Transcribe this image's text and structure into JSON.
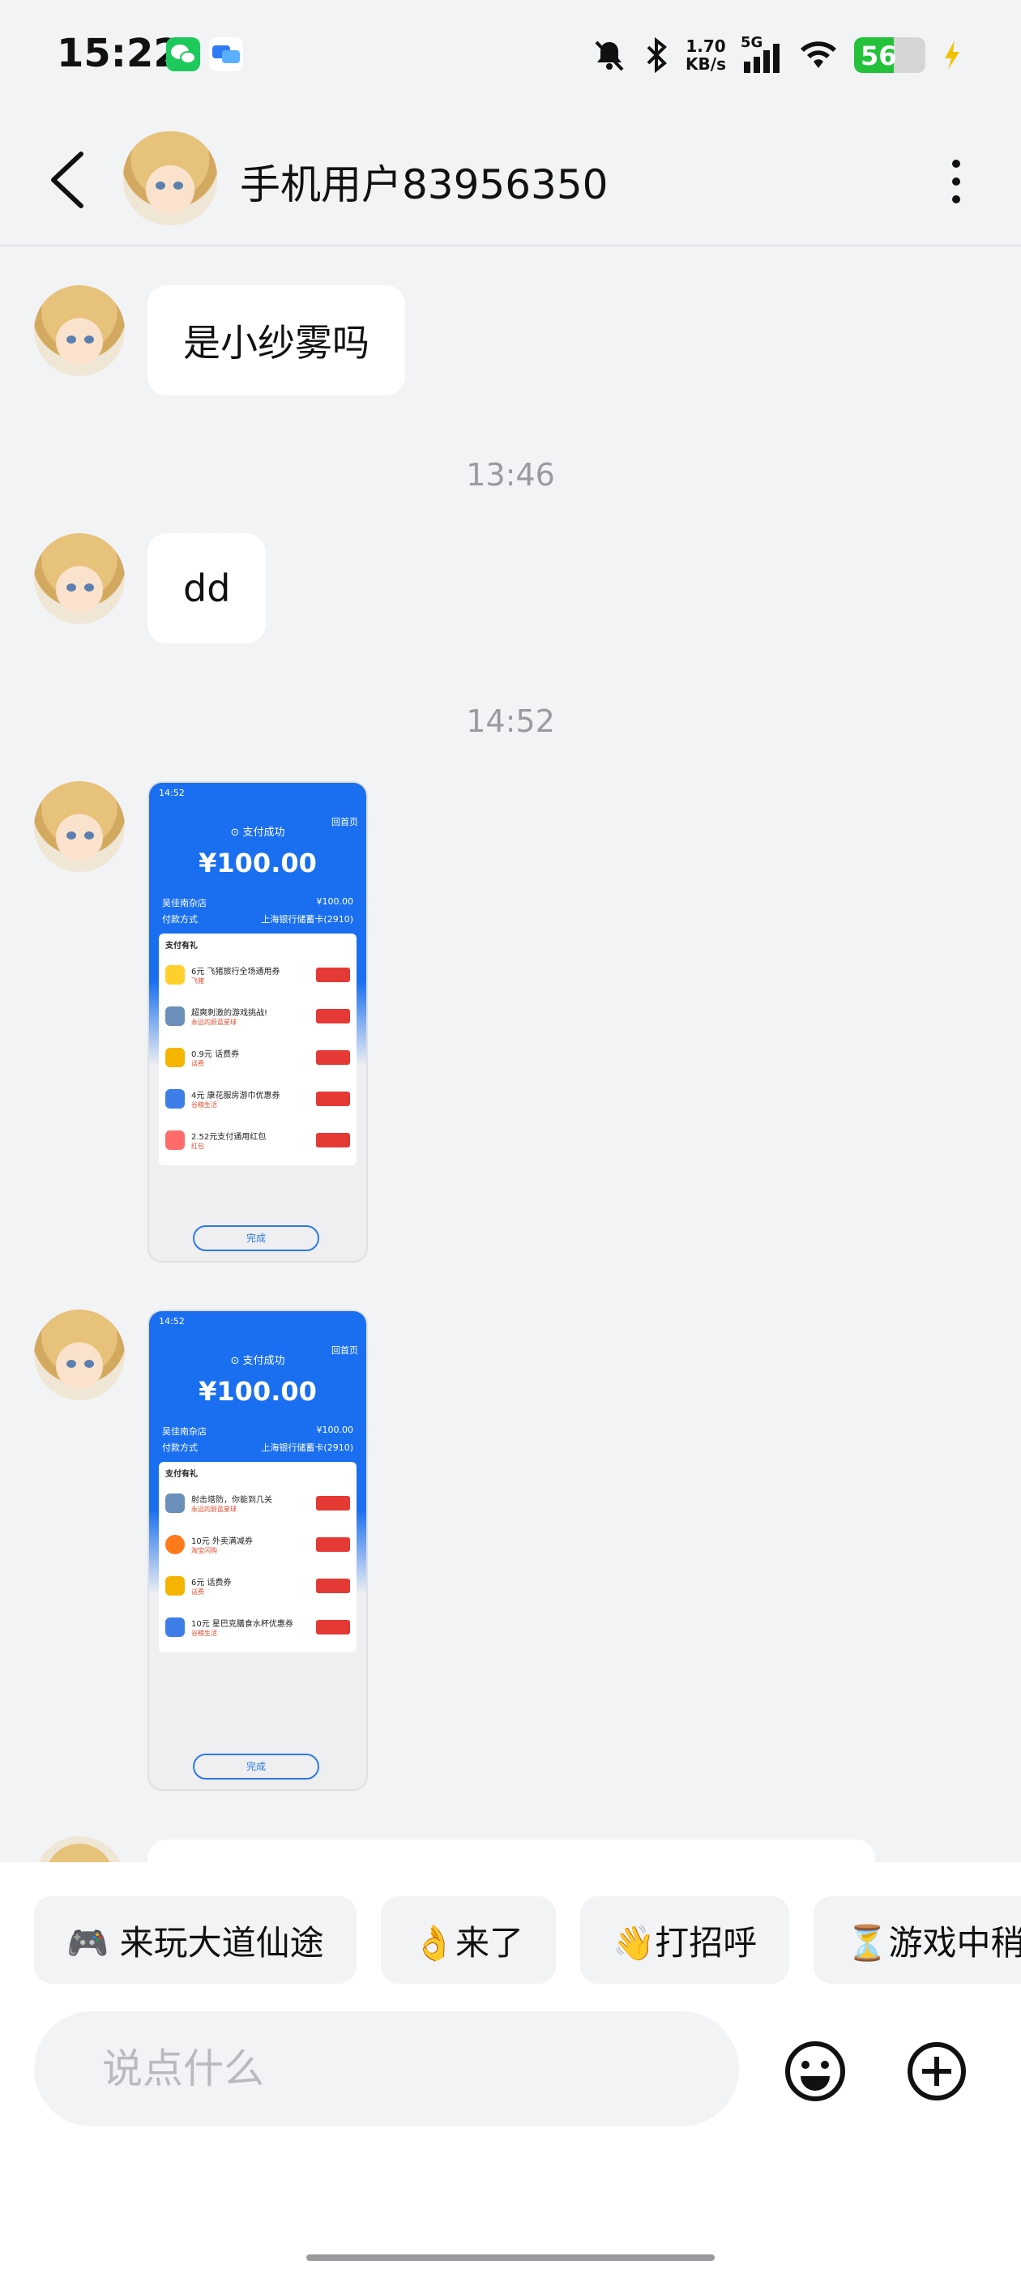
{
  "status_bar": {
    "time": "15:22",
    "speed_value": "1.70",
    "speed_unit": "KB/s",
    "network": "5G",
    "battery": "56",
    "battery_level": 0.56,
    "icons": [
      "wechat-icon",
      "message-app-icon",
      "mute-bell-icon",
      "bluetooth-icon",
      "signal-icon",
      "wifi-icon",
      "battery-icon",
      "charging-icon"
    ]
  },
  "header": {
    "title": "手机用户83956350",
    "back_icon": "chevron-left-icon",
    "more_icon": "vertical-dots-icon"
  },
  "messages": [
    {
      "type": "text",
      "text": "是小纱雾吗"
    },
    {
      "type": "time",
      "text": "13:46"
    },
    {
      "type": "text",
      "text": "dd"
    },
    {
      "type": "time",
      "text": "14:52"
    },
    {
      "type": "image"
    },
    {
      "type": "image"
    }
  ],
  "shot1": {
    "status_time": "14:52",
    "success": "⊙ 支付成功",
    "home": "回首页",
    "amount": "¥100.00",
    "merchant_label": "吴佳南杂店",
    "merchant_value": "¥100.00",
    "pay_label": "付款方式",
    "pay_value": "上海银行储蓄卡(2910)",
    "card_title": "支付有礼",
    "items": [
      {
        "title": "6元 飞猪旅行全场通用券",
        "sub": "飞猪"
      },
      {
        "title": "超爽刺激的游戏挑战!",
        "sub": "永远的蔚蓝星球"
      },
      {
        "title": "0.9元 话费券",
        "sub": "话费"
      },
      {
        "title": "4元 康花服房游巾优惠券",
        "sub": "谷粮生活"
      },
      {
        "title": "2.52元支付通用红包",
        "sub": "红包"
      }
    ],
    "done": "完成"
  },
  "shot2": {
    "status_time": "14:52",
    "success": "⊙ 支付成功",
    "home": "回首页",
    "amount": "¥100.00",
    "merchant_label": "吴佳南杂店",
    "merchant_value": "¥100.00",
    "pay_label": "付款方式",
    "pay_value": "上海银行储蓄卡(2910)",
    "card_title": "支付有礼",
    "items": [
      {
        "title": "射击塔防，你能到几关",
        "sub": "永远的蔚蓝星球"
      },
      {
        "title": "10元 外卖满减券",
        "sub": "淘宝闪购"
      },
      {
        "title": "6元 话费券",
        "sub": "话费"
      },
      {
        "title": "10元 星巴克膳食水杯优惠券",
        "sub": "谷粮生活"
      }
    ],
    "done": "完成"
  },
  "quick_replies": [
    "🎮 来玩大道仙途",
    "👌来了",
    "👋打招呼",
    "⏳游戏中稍"
  ],
  "input": {
    "placeholder": "说点什么",
    "value": ""
  },
  "toolbar": {
    "emoji_icon": "smiley-icon",
    "plus_icon": "plus-circle-icon"
  },
  "colors": {
    "accent_blue": "#1a6ff0",
    "bubble": "#ffffff",
    "background": "#f2f3f5",
    "wechat_green": "#1ec95c",
    "battery_green": "#23c23a"
  }
}
